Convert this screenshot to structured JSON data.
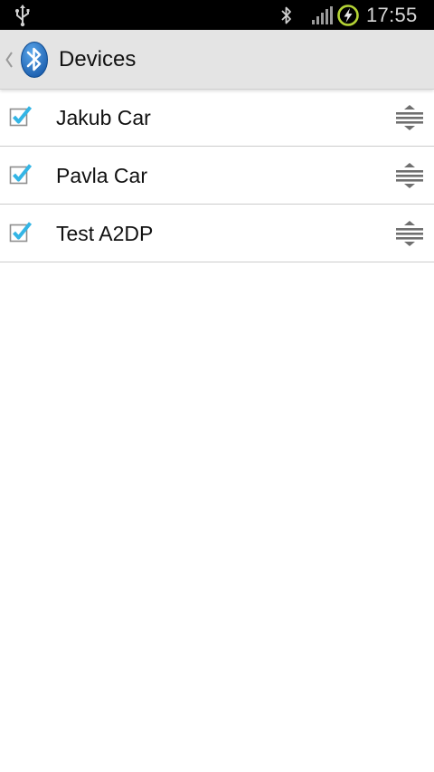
{
  "status_bar": {
    "time": "17:55",
    "icons": [
      "usb-icon",
      "bluetooth-icon",
      "signal-icon",
      "battery-charging-icon"
    ],
    "battery_ring_color": "#b5d436"
  },
  "action_bar": {
    "title": "Devices",
    "app_icon": "bluetooth-icon",
    "up_icon": "chevron-left-icon"
  },
  "devices": [
    {
      "name": "Jakub Car",
      "checked": true
    },
    {
      "name": "Pavla Car",
      "checked": true
    },
    {
      "name": "Test A2DP",
      "checked": true
    }
  ],
  "colors": {
    "checkbox_accent": "#33b5e5",
    "bluetooth_blue": "#1e6fc0"
  }
}
